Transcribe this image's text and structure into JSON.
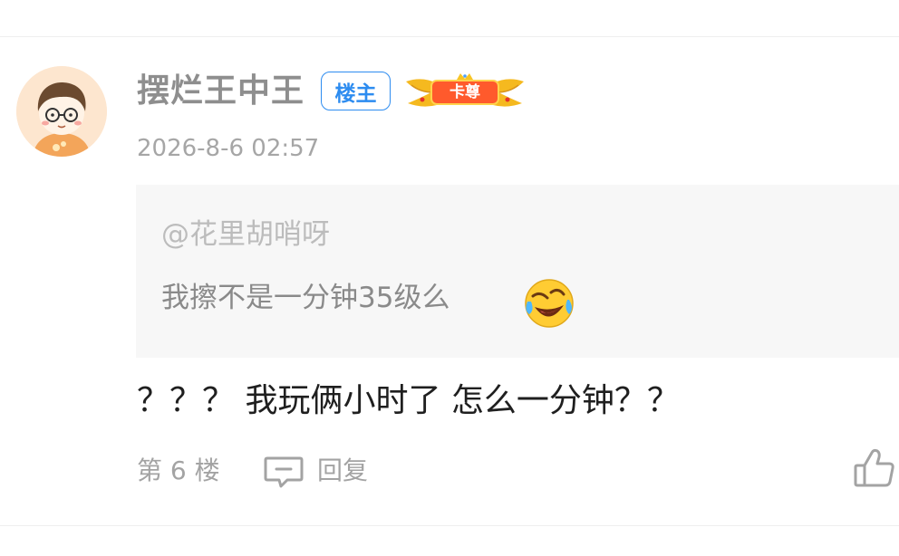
{
  "comment": {
    "username": "摆烂王中王",
    "op_badge": "楼主",
    "rank_badge": "卡尊",
    "timestamp": "2026-8-6 02:57",
    "quote": {
      "user": "@花里胡哨呀",
      "text": "我擦不是一分钟35级么",
      "emoji": "laughing-crying-emoji"
    },
    "text": "？？？ 我玩俩小时了 怎么一分钟？？",
    "floor": "第 6 楼",
    "reply_label": "回复"
  },
  "colors": {
    "op_badge": "#2d8cf0",
    "rank_badge": "#ff5a2c",
    "quote_background": "#f7f7f7"
  },
  "icons": {
    "reply": "comment-bubble-icon",
    "like": "thumbs-up-icon"
  }
}
